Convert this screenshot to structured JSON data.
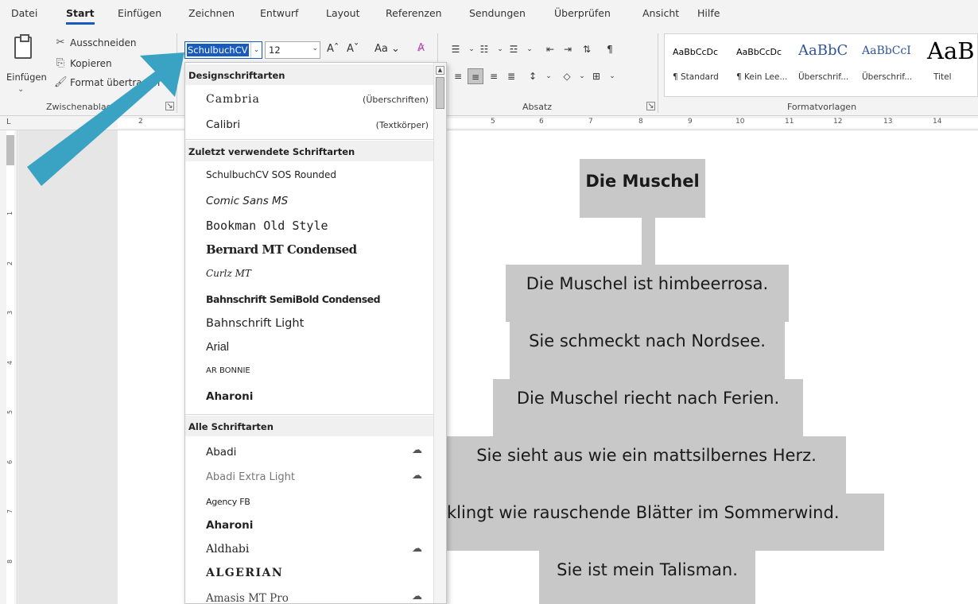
{
  "menu": {
    "tabs": [
      "Datei",
      "Start",
      "Einfügen",
      "Zeichnen",
      "Entwurf",
      "Layout",
      "Referenzen",
      "Sendungen",
      "Überprüfen",
      "Ansicht",
      "Hilfe"
    ],
    "active": "Start"
  },
  "clipboard": {
    "paste_label": "Einfügen",
    "cut_label": "Ausschneiden",
    "copy_label": "Kopieren",
    "format_label": "Format übertragen",
    "group_label": "Zwischenablage"
  },
  "font": {
    "current_font": "SchulbuchCV",
    "current_size": "12",
    "case_label": "Aa"
  },
  "paragraph": {
    "group_label": "Absatz"
  },
  "styles": {
    "group_label": "Formatvorlagen",
    "items": [
      {
        "preview": "AaBbCcDc",
        "name": "¶ Standard"
      },
      {
        "preview": "AaBbCcDc",
        "name": "¶ Kein Lee..."
      },
      {
        "preview": "AaBbC",
        "name": "Überschrif..."
      },
      {
        "preview": "AaBbCcI",
        "name": "Überschrif..."
      },
      {
        "preview": "AaB",
        "name": "Titel"
      }
    ]
  },
  "ruler": {
    "h_numbers": [
      "2",
      "5",
      "6",
      "7",
      "8",
      "9",
      "10",
      "11",
      "12",
      "13",
      "14"
    ],
    "v_numbers": [
      "1",
      "2",
      "3",
      "4",
      "5",
      "6",
      "7",
      "8"
    ]
  },
  "font_dropdown": {
    "design_header": "Designschriftarten",
    "design_fonts": [
      {
        "name": "Cambria",
        "tag": "(Überschriften)"
      },
      {
        "name": "Calibri",
        "tag": "(Textkörper)"
      }
    ],
    "recent_header": "Zuletzt verwendete Schriftarten",
    "recent_fonts": [
      "SchulbuchCV SOS Rounded",
      "Comic Sans MS",
      "Bookman Old Style",
      "Bernard MT Condensed",
      "Curlz MT",
      "Bahnschrift SemiBold Condensed",
      "Bahnschrift Light",
      "Arial",
      "AR BONNIE",
      "Aharoni"
    ],
    "all_header": "Alle Schriftarten",
    "all_fonts": [
      "Abadi",
      "Abadi Extra Light",
      "Agency FB",
      "Aharoni",
      "Aldhabi",
      "ALGERIAN",
      "Amasis MT Pro"
    ]
  },
  "document": {
    "title": "Die Muschel",
    "lines": [
      "Die Muschel ist himbeerrosa.",
      "Sie schmeckt nach Nordsee.",
      "Die Muschel riecht nach Ferien.",
      "Sie sieht aus wie ein mattsilbernes Herz.",
      "klingt wie rauschende Blätter im Sommerwind.",
      "Sie ist mein Talisman."
    ]
  },
  "colors": {
    "accent": "#185abd",
    "arrow": "#3aa3c3",
    "highlight": "#c8c8c8"
  }
}
